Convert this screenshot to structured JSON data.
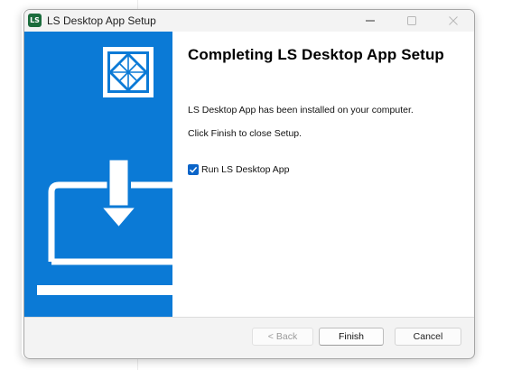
{
  "window": {
    "title": "LS Desktop App Setup",
    "icon_text": "LS",
    "icon_color": "#1b6c3c",
    "controls": [
      "minimize-icon",
      "maximize-icon",
      "close-icon"
    ]
  },
  "sidebar": {
    "background": "#0b7ad6",
    "logo_icon": "ls-logo-icon",
    "illustration_icon": "laptop-download-icon"
  },
  "main": {
    "heading": "Completing LS Desktop App Setup",
    "line1": "LS Desktop App has been installed on your computer.",
    "line2": "Click Finish to close Setup.",
    "run_checkbox": {
      "label": "Run LS Desktop App",
      "checked": true
    }
  },
  "buttons": {
    "back": "< Back",
    "finish": "Finish",
    "cancel": "Cancel"
  },
  "colors": {
    "accent": "#0a64c8",
    "sidebar": "#0b7ad6"
  }
}
